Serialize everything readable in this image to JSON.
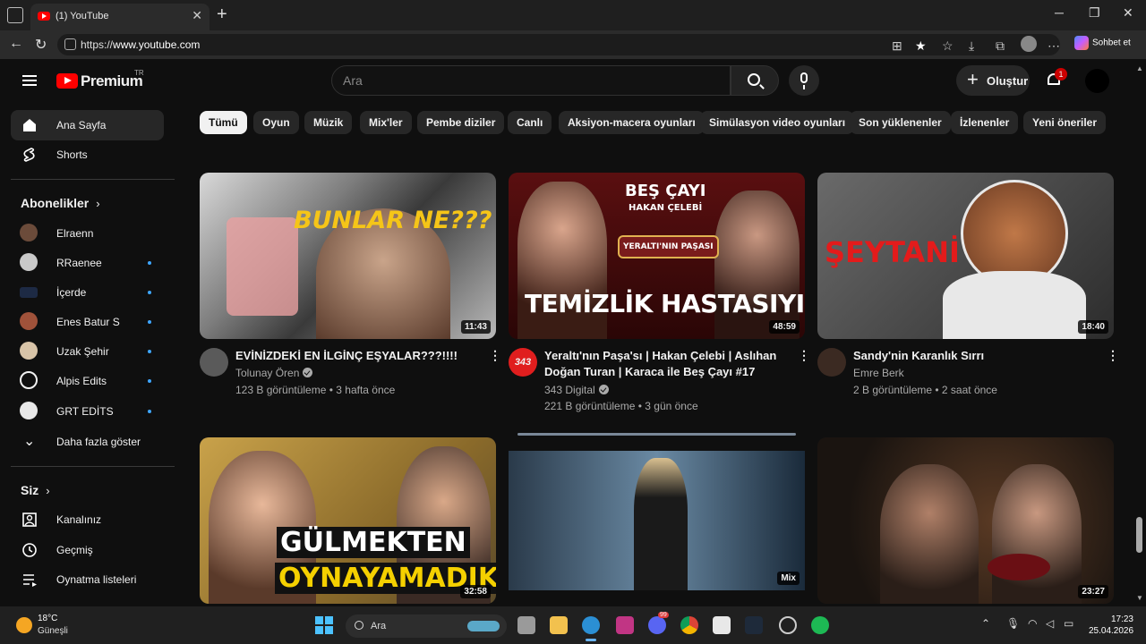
{
  "browser": {
    "tab_title": "(1) YouTube",
    "url_prefix": "https://",
    "url_host": "www.youtube.com",
    "chat_label": "Sohbet et"
  },
  "header": {
    "brand": "Premium",
    "country": "TR",
    "search_placeholder": "Ara",
    "create_label": "Oluştur",
    "notifications_count": "1"
  },
  "sidebar": {
    "main": [
      {
        "label": "Ana Sayfa",
        "icon": "home-icon"
      },
      {
        "label": "Shorts",
        "icon": "shorts-icon"
      }
    ],
    "subscriptions_title": "Abonelikler",
    "subscriptions": [
      {
        "label": "Elraenn",
        "color": "#6b4b3a",
        "dot": false
      },
      {
        "label": "RRaenee",
        "color": "#c9c9c9",
        "dot": true
      },
      {
        "label": "İçerde",
        "color": "#1d2a44",
        "dot": true
      },
      {
        "label": "Enes Batur S",
        "color": "#a0523a",
        "dot": true
      },
      {
        "label": "Uzak Şehir",
        "color": "#d8c4a8",
        "dot": true
      },
      {
        "label": "Alpis Edits",
        "color": "#f1f1f1",
        "dot": true
      },
      {
        "label": "GRT EDİTS",
        "color": "#e8e8e8",
        "dot": true
      }
    ],
    "show_more": "Daha fazla göster",
    "you_title": "Siz",
    "you_items": [
      {
        "label": "Kanalınız",
        "icon": "channel-icon"
      },
      {
        "label": "Geçmiş",
        "icon": "history-icon"
      },
      {
        "label": "Oynatma listeleri",
        "icon": "playlists-icon"
      }
    ]
  },
  "chips": [
    "Tümü",
    "Oyun",
    "Müzik",
    "Mix'ler",
    "Pembe diziler",
    "Canlı",
    "Aksiyon-macera oyunları",
    "Simülasyon video oyunları",
    "Son yüklenenler",
    "İzlenenler",
    "Yeni öneriler"
  ],
  "videos": [
    {
      "title_lines": [
        "EVİNİZDEKİ EN İLGİNÇ EŞYALAR???!!!!"
      ],
      "channel": "Tolunay Ören",
      "verified": true,
      "meta": "123 B görüntüleme • 3 hafta önce",
      "duration": "11:43",
      "overlay": "BUNLAR NE???"
    },
    {
      "title_lines": [
        "Yeraltı'nın Paşa'sı | Hakan Çelebi | Aslıhan",
        "Doğan Turan | Karaca ile Beş Çayı #17"
      ],
      "channel": "343 Digital",
      "verified": true,
      "meta": "221 B görüntüleme • 3 gün önce",
      "duration": "48:59",
      "overlay": "TEMİZLİK HASTASIYIM",
      "overlay_top": "BEŞ ÇAYI",
      "overlay_sub": "HAKAN ÇELEBİ",
      "overlay_sign": "YERALTI'NIN PAŞASI",
      "avatar_text": "343"
    },
    {
      "title_lines": [
        "Sandy'nin Karanlık Sırrı"
      ],
      "channel": "Emre Berk",
      "verified": false,
      "meta": "2 B görüntüleme • 2 saat önce",
      "duration": "18:40",
      "overlay": "ŞEYTANİ"
    },
    {
      "duration": "32:58",
      "overlay": "GÜLMEKTEN",
      "overlay2": "OYNAYAMADIK"
    },
    {
      "duration": "Mix"
    },
    {
      "duration": "23:27"
    }
  ],
  "taskbar": {
    "temp": "18°C",
    "weather": "Güneşli",
    "search_label": "Ara",
    "time": "17:23",
    "date": "25.04.2026",
    "discord_badge": "99"
  }
}
